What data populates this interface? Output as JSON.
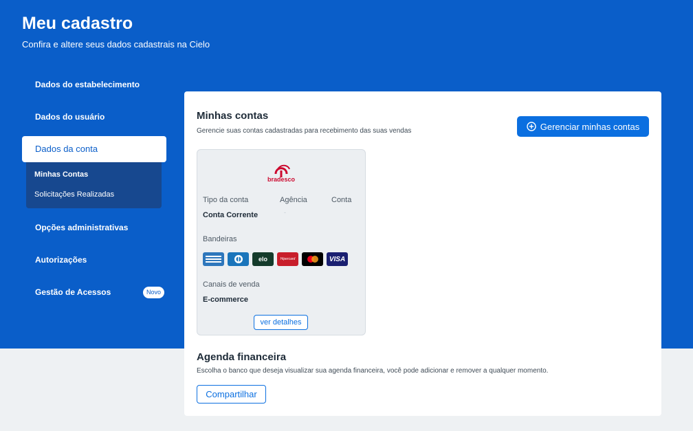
{
  "header": {
    "title": "Meu cadastro",
    "subtitle": "Confira e altere seus dados cadastrais na Cielo"
  },
  "sidebar": {
    "items": [
      {
        "label": "Dados do estabelecimento"
      },
      {
        "label": "Dados do usuário"
      },
      {
        "label": "Dados da conta",
        "active": true,
        "subitems": [
          {
            "label": "Minhas Contas",
            "active": true
          },
          {
            "label": "Solicitações Realizadas"
          }
        ]
      },
      {
        "label": "Opções administrativas"
      },
      {
        "label": "Autorizações"
      },
      {
        "label": "Gestão de Acessos",
        "badge": "Novo"
      }
    ]
  },
  "accounts": {
    "title": "Minhas contas",
    "description": "Gerencie suas contas cadastradas para recebimento das suas vendas",
    "manage_button": "Gerenciar minhas contas",
    "card": {
      "bank_name": "bradesco",
      "bank_logo_icon": "bradesco-logo-icon",
      "account_type_label": "Tipo da conta",
      "agency_label": "Agência",
      "account_label": "Conta",
      "account_type_value": "Conta Corrente",
      "agency_value": "-",
      "brands_label": "Bandeiras",
      "brands": [
        {
          "name": "American Express",
          "icon": "amex-icon",
          "text": "AMERICAN EXPRESS",
          "bg": "#2e77bc",
          "color": "#ffffff"
        },
        {
          "name": "Diners Club",
          "icon": "diners-icon",
          "text": "",
          "bg": "#1b75bb",
          "color": "#ffffff"
        },
        {
          "name": "Elo",
          "icon": "elo-icon",
          "text": "elo",
          "bg": "#143b2b",
          "color": "#ffffff"
        },
        {
          "name": "Hipercard",
          "icon": "hipercard-icon",
          "text": "Hipercard",
          "bg": "#c81e2b",
          "color": "#ffffff"
        },
        {
          "name": "Mastercard",
          "icon": "mastercard-icon",
          "text": "",
          "bg": "#000000",
          "color": "#ffffff"
        },
        {
          "name": "Visa",
          "icon": "visa-icon",
          "text": "VISA",
          "bg": "#1a1f71",
          "color": "#ffffff"
        }
      ],
      "sales_channels_label": "Canais de venda",
      "sales_channels_value": "E-commerce",
      "details_button": "ver detalhes"
    }
  },
  "agenda": {
    "title": "Agenda financeira",
    "description": "Escolha o banco que deseja visualizar sua agenda financeira, você pode adicionar e remover a qualquer momento.",
    "share_button": "Compartilhar"
  },
  "colors": {
    "brand_blue": "#0a5ec9",
    "button_blue": "#0b6fe0",
    "submenu_blue": "#17488f",
    "bradesco_red": "#cc092f",
    "page_background": "#eef1f3"
  }
}
